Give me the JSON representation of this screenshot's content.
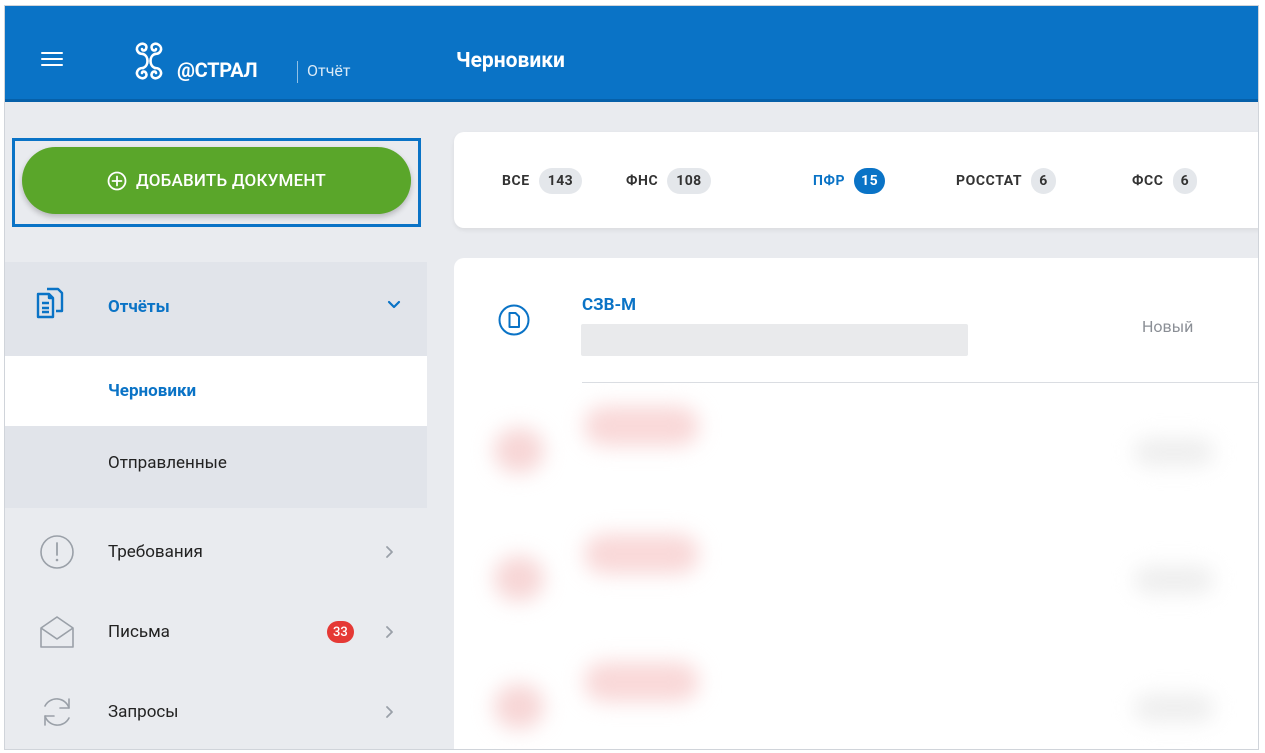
{
  "header": {
    "logo_text": "@СТРАЛ",
    "logo_sub": "Отчёт",
    "page_title": "Черновики"
  },
  "sidebar": {
    "add_button_label": "ДОБАВИТЬ ДОКУМЕНТ",
    "reports": {
      "label": "Отчёты",
      "items": [
        {
          "label": "Черновики",
          "active": true
        },
        {
          "label": "Отправленные",
          "active": false
        }
      ]
    },
    "items": [
      {
        "label": "Требования",
        "icon": "exclamation-icon"
      },
      {
        "label": "Письма",
        "icon": "envelope-icon",
        "badge": "33"
      },
      {
        "label": "Запросы",
        "icon": "refresh-icon"
      }
    ]
  },
  "filter_tabs": [
    {
      "label": "ВСЕ",
      "count": "143",
      "active": false
    },
    {
      "label": "ФНС",
      "count": "108",
      "active": false
    },
    {
      "label": "ПФР",
      "count": "15",
      "active": true
    },
    {
      "label": "РОССТАТ",
      "count": "6",
      "active": false
    },
    {
      "label": "ФСС",
      "count": "6",
      "active": false
    }
  ],
  "documents": [
    {
      "title": "СЗВ-М",
      "status": "Новый"
    }
  ],
  "colors": {
    "brand_blue": "#0a73c6",
    "add_button_green": "#5aa62a",
    "badge_red": "#e53935"
  }
}
